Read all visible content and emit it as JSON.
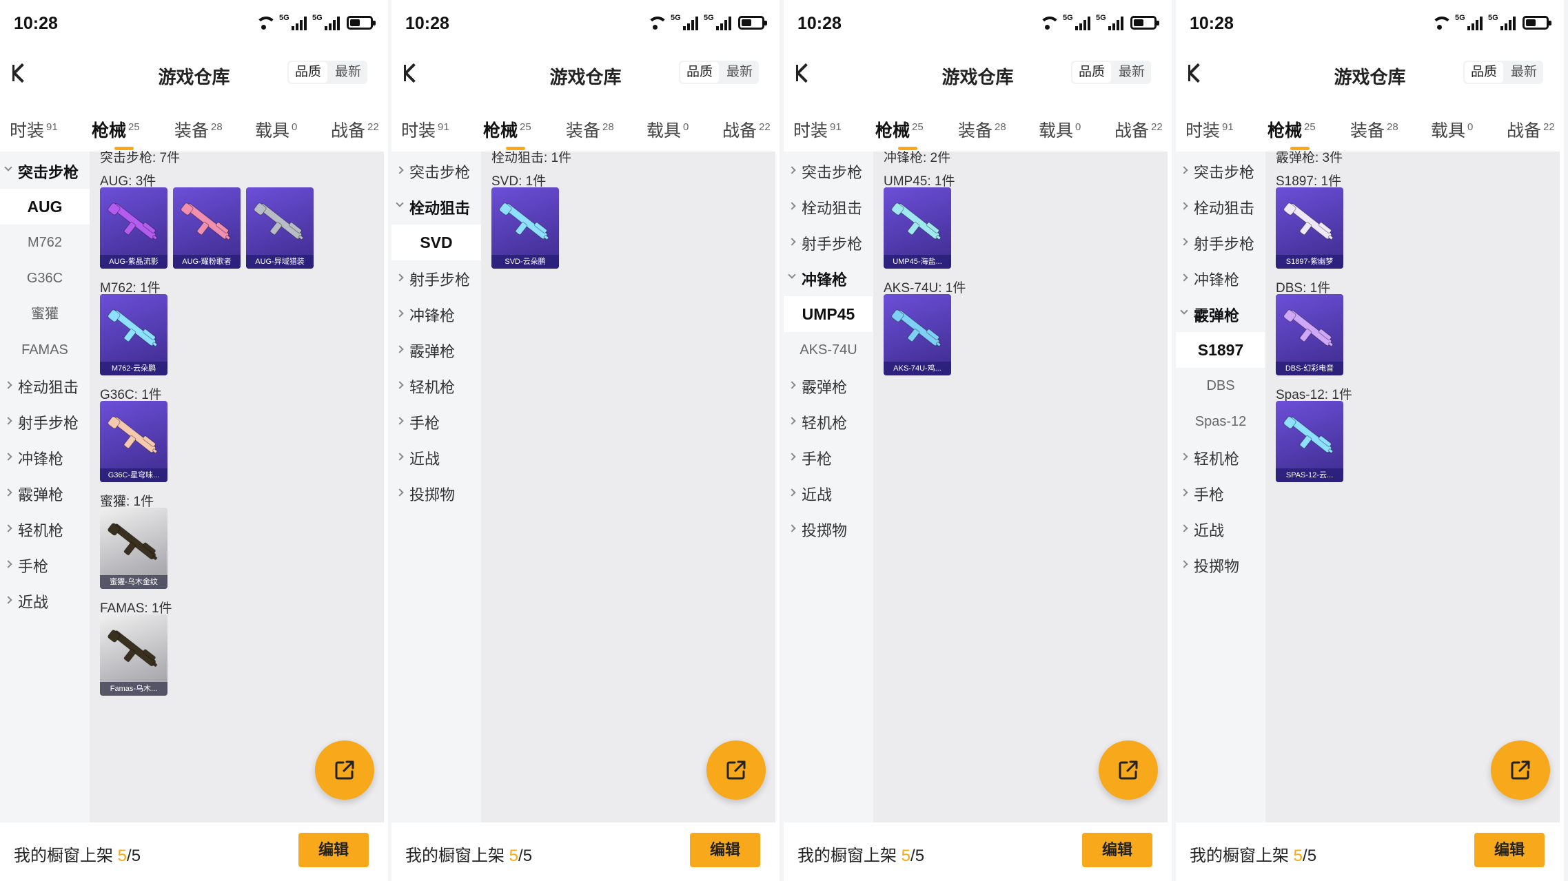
{
  "status": {
    "time": "10:28",
    "network_label": "5G"
  },
  "nav": {
    "title": "游戏仓库",
    "sort_quality": "品质",
    "sort_latest": "最新"
  },
  "tabs": [
    {
      "label": "时装",
      "count": "91"
    },
    {
      "label": "枪械",
      "count": "25"
    },
    {
      "label": "装备",
      "count": "28"
    },
    {
      "label": "载具",
      "count": "0"
    },
    {
      "label": "战备",
      "count": "22"
    }
  ],
  "bottom": {
    "label": "我的橱窗上架",
    "current": "5",
    "total": "/5",
    "edit_label": "编辑"
  },
  "colors": {
    "accent": "#f7a81b",
    "card_purple": "#6c4fd8"
  },
  "screens": [
    {
      "sidebar": [
        {
          "kind": "open",
          "label": "突击步枪"
        },
        {
          "kind": "sel",
          "label": "AUG"
        },
        {
          "kind": "sub",
          "label": "M762"
        },
        {
          "kind": "sub",
          "label": "G36C"
        },
        {
          "kind": "sub",
          "label": "蜜獾"
        },
        {
          "kind": "sub",
          "label": "FAMAS"
        },
        {
          "kind": "closed",
          "label": "栓动狙击"
        },
        {
          "kind": "closed",
          "label": "射手步枪"
        },
        {
          "kind": "closed",
          "label": "冲锋枪"
        },
        {
          "kind": "closed",
          "label": "霰弹枪"
        },
        {
          "kind": "closed",
          "label": "轻机枪"
        },
        {
          "kind": "closed",
          "label": "手枪"
        },
        {
          "kind": "closed",
          "label": "近战"
        }
      ],
      "category_title": "突击步枪: 7件",
      "groups": [
        {
          "title": "AUG: 3件",
          "items": [
            {
              "name": "AUG-紫晶流影",
              "gun_color": "#b45cf0",
              "style": "purple"
            },
            {
              "name": "AUG-耀粉歌者",
              "gun_color": "#f08fb0",
              "style": "purple"
            },
            {
              "name": "AUG-异域猎装",
              "gun_color": "#b8bcc4",
              "style": "purple"
            }
          ]
        },
        {
          "title": "M762: 1件",
          "items": [
            {
              "name": "M762-云朵鹏",
              "gun_color": "#8ee0ff",
              "style": "purple"
            }
          ]
        },
        {
          "title": "G36C: 1件",
          "items": [
            {
              "name": "G36C-星穹味...",
              "gun_color": "#f5c8b0",
              "style": "purple"
            }
          ]
        },
        {
          "title": "蜜獾: 1件",
          "items": [
            {
              "name": "蜜獾-乌木金纹",
              "gun_color": "#3a3020",
              "style": "gold"
            }
          ]
        },
        {
          "title": "FAMAS: 1件",
          "items": [
            {
              "name": "Famas-乌木...",
              "gun_color": "#3a3020",
              "style": "gold"
            }
          ]
        }
      ]
    },
    {
      "sidebar": [
        {
          "kind": "closed",
          "label": "突击步枪"
        },
        {
          "kind": "open",
          "label": "栓动狙击"
        },
        {
          "kind": "sel",
          "label": "SVD"
        },
        {
          "kind": "closed",
          "label": "射手步枪"
        },
        {
          "kind": "closed",
          "label": "冲锋枪"
        },
        {
          "kind": "closed",
          "label": "霰弹枪"
        },
        {
          "kind": "closed",
          "label": "轻机枪"
        },
        {
          "kind": "closed",
          "label": "手枪"
        },
        {
          "kind": "closed",
          "label": "近战"
        },
        {
          "kind": "closed",
          "label": "投掷物"
        }
      ],
      "category_title": "栓动狙击: 1件",
      "groups": [
        {
          "title": "SVD: 1件",
          "items": [
            {
              "name": "SVD-云朵鹏",
              "gun_color": "#8ee0ff",
              "style": "purple"
            }
          ]
        }
      ]
    },
    {
      "sidebar": [
        {
          "kind": "closed",
          "label": "突击步枪"
        },
        {
          "kind": "closed",
          "label": "栓动狙击"
        },
        {
          "kind": "closed",
          "label": "射手步枪"
        },
        {
          "kind": "open",
          "label": "冲锋枪"
        },
        {
          "kind": "sel",
          "label": "UMP45"
        },
        {
          "kind": "sub",
          "label": "AKS-74U"
        },
        {
          "kind": "closed",
          "label": "霰弹枪"
        },
        {
          "kind": "closed",
          "label": "轻机枪"
        },
        {
          "kind": "closed",
          "label": "手枪"
        },
        {
          "kind": "closed",
          "label": "近战"
        },
        {
          "kind": "closed",
          "label": "投掷物"
        }
      ],
      "category_title": "冲锋枪: 2件",
      "groups": [
        {
          "title": "UMP45: 1件",
          "items": [
            {
              "name": "UMP45-海盐...",
              "gun_color": "#9fe8f0",
              "style": "purple"
            }
          ]
        },
        {
          "title": "AKS-74U: 1件",
          "items": [
            {
              "name": "AKS-74U-鸡...",
              "gun_color": "#7ed0f5",
              "style": "purple"
            }
          ]
        }
      ]
    },
    {
      "sidebar": [
        {
          "kind": "closed",
          "label": "突击步枪"
        },
        {
          "kind": "closed",
          "label": "栓动狙击"
        },
        {
          "kind": "closed",
          "label": "射手步枪"
        },
        {
          "kind": "closed",
          "label": "冲锋枪"
        },
        {
          "kind": "open",
          "label": "霰弹枪"
        },
        {
          "kind": "sel",
          "label": "S1897"
        },
        {
          "kind": "sub",
          "label": "DBS"
        },
        {
          "kind": "sub",
          "label": "Spas-12"
        },
        {
          "kind": "closed",
          "label": "轻机枪"
        },
        {
          "kind": "closed",
          "label": "手枪"
        },
        {
          "kind": "closed",
          "label": "近战"
        },
        {
          "kind": "closed",
          "label": "投掷物"
        }
      ],
      "category_title": "霰弹枪: 3件",
      "groups": [
        {
          "title": "S1897: 1件",
          "items": [
            {
              "name": "S1897-紫幽梦",
              "gun_color": "#f0e8f8",
              "style": "purple"
            }
          ]
        },
        {
          "title": "DBS: 1件",
          "items": [
            {
              "name": "DBS-幻彩电音",
              "gun_color": "#d0a8f8",
              "style": "purple"
            }
          ]
        },
        {
          "title": "Spas-12: 1件",
          "items": [
            {
              "name": "SPAS-12-云...",
              "gun_color": "#8ee0ff",
              "style": "purple"
            }
          ]
        }
      ]
    }
  ]
}
